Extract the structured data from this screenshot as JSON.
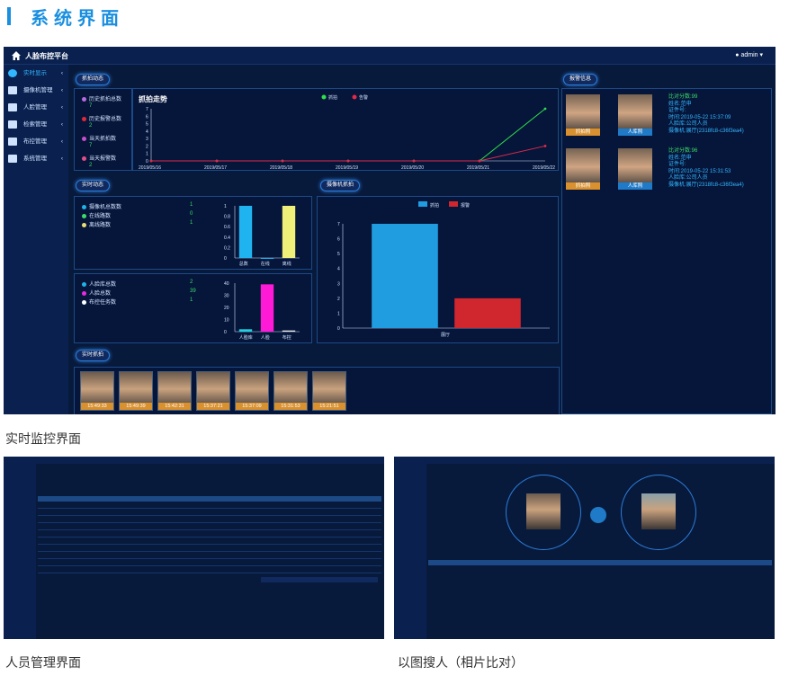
{
  "heading": "系统界面",
  "app": {
    "title": "人脸布控平台",
    "user": "admin",
    "sidebar": [
      {
        "label": "实时显示",
        "icon": "clock-icon"
      },
      {
        "label": "摄像机管理",
        "icon": "video-camera-icon"
      },
      {
        "label": "人脸管理",
        "icon": "users-icon"
      },
      {
        "label": "检索管理",
        "icon": "person-search-icon"
      },
      {
        "label": "布控管理",
        "icon": "monitor-icon"
      },
      {
        "label": "系统管理",
        "icon": "gears-icon"
      }
    ],
    "section_tags": {
      "capture_trend": "抓拍动态",
      "realtime": "实时动态",
      "camera_capture": "摄像机抓拍",
      "realtime_capture": "实时抓拍",
      "alarm_info": "报警信息"
    },
    "capture_stats": [
      {
        "label": "历史抓拍总数",
        "value": "7",
        "color": "#b86be0"
      },
      {
        "label": "历史报警总数",
        "value": "2",
        "color": "#e02a3a"
      },
      {
        "label": "当天抓拍数",
        "value": "7",
        "color": "#c84fc8"
      },
      {
        "label": "当天报警数",
        "value": "2",
        "color": "#e04f8a"
      }
    ],
    "camera_stats": [
      {
        "label": "摄像机总数数",
        "value": "1",
        "color": "#1fb4e8"
      },
      {
        "label": "在线路数",
        "value": "0",
        "color": "#3ddc6a"
      },
      {
        "label": "离线路数",
        "value": "1",
        "color": "#e8e070"
      }
    ],
    "face_stats": [
      {
        "label": "人脸库总数",
        "value": "2",
        "color": "#1fb4e8"
      },
      {
        "label": "人脸总数",
        "value": "39",
        "color": "#e82ae0"
      },
      {
        "label": "布控任务数",
        "value": "1",
        "color": "#ffffff"
      }
    ],
    "alarms": [
      {
        "score": "比对分数:99",
        "name": "姓名:范申",
        "id": "证件号:",
        "time": "时间:2019-05-22 15:37:09",
        "library": "人脸库:公司人员",
        "camera": "摄像机:展厅(2318fc8-c36f3ea4)",
        "cap_label": "抓拍照",
        "db_label": "人库照"
      },
      {
        "score": "比对分数:96",
        "name": "姓名:范申",
        "id": "证件号:",
        "time": "时间:2019-05-22 15:31:53",
        "library": "人脸库:公司人员",
        "camera": "摄像机:展厅(2318fc8-c36f3ea4)",
        "cap_label": "抓拍照",
        "db_label": "人库照"
      }
    ],
    "capture_times": [
      "15:49:33",
      "15:49:39",
      "15:42:31",
      "15:37:21",
      "15:37:09",
      "15:31:53",
      "15:21:51"
    ]
  },
  "captions": {
    "main": "实时监控界面",
    "people": "人员管理界面",
    "search": "以图搜人（相片比对）"
  },
  "chart_data": [
    {
      "type": "line",
      "title": "抓拍走势",
      "categories": [
        "2019/05/16",
        "2019/05/17",
        "2019/05/18",
        "2019/05/19",
        "2019/05/20",
        "2019/05/21",
        "2019/05/22"
      ],
      "series": [
        {
          "name": "抓拍",
          "color": "#2ee04a",
          "values": [
            0,
            0,
            0,
            0,
            0,
            0,
            7
          ]
        },
        {
          "name": "告警",
          "color": "#e02a4a",
          "values": [
            0,
            0,
            0,
            0,
            0,
            0,
            2
          ]
        }
      ],
      "ylim": [
        0,
        7
      ],
      "yticks": [
        0,
        1,
        2,
        3,
        4,
        5,
        6,
        7
      ]
    },
    {
      "type": "bar",
      "categories": [
        "总数",
        "在线",
        "离线"
      ],
      "values": [
        1,
        0,
        1
      ],
      "colors": [
        "#1fb4f0",
        "#1fb4f0",
        "#eef07a"
      ],
      "ylim": [
        0,
        1
      ],
      "yticks": [
        0,
        0.2,
        0.4,
        0.6,
        0.8,
        1
      ]
    },
    {
      "type": "bar",
      "categories": [
        "人脸库",
        "人脸",
        "布控"
      ],
      "values": [
        2,
        39,
        1
      ],
      "colors": [
        "#1fd0e0",
        "#ff1ad8",
        "#e8e8e8"
      ],
      "ylim": [
        0,
        40
      ],
      "yticks": [
        0,
        10,
        20,
        30,
        40
      ]
    },
    {
      "type": "bar",
      "categories": [
        "展厅"
      ],
      "series": [
        {
          "name": "抓拍",
          "color": "#1f9de0",
          "values": [
            7
          ]
        },
        {
          "name": "报警",
          "color": "#d0262e",
          "values": [
            2
          ]
        }
      ],
      "ylim": [
        0,
        7
      ],
      "yticks": [
        0,
        1,
        2,
        3,
        4,
        5,
        6,
        7
      ]
    }
  ]
}
